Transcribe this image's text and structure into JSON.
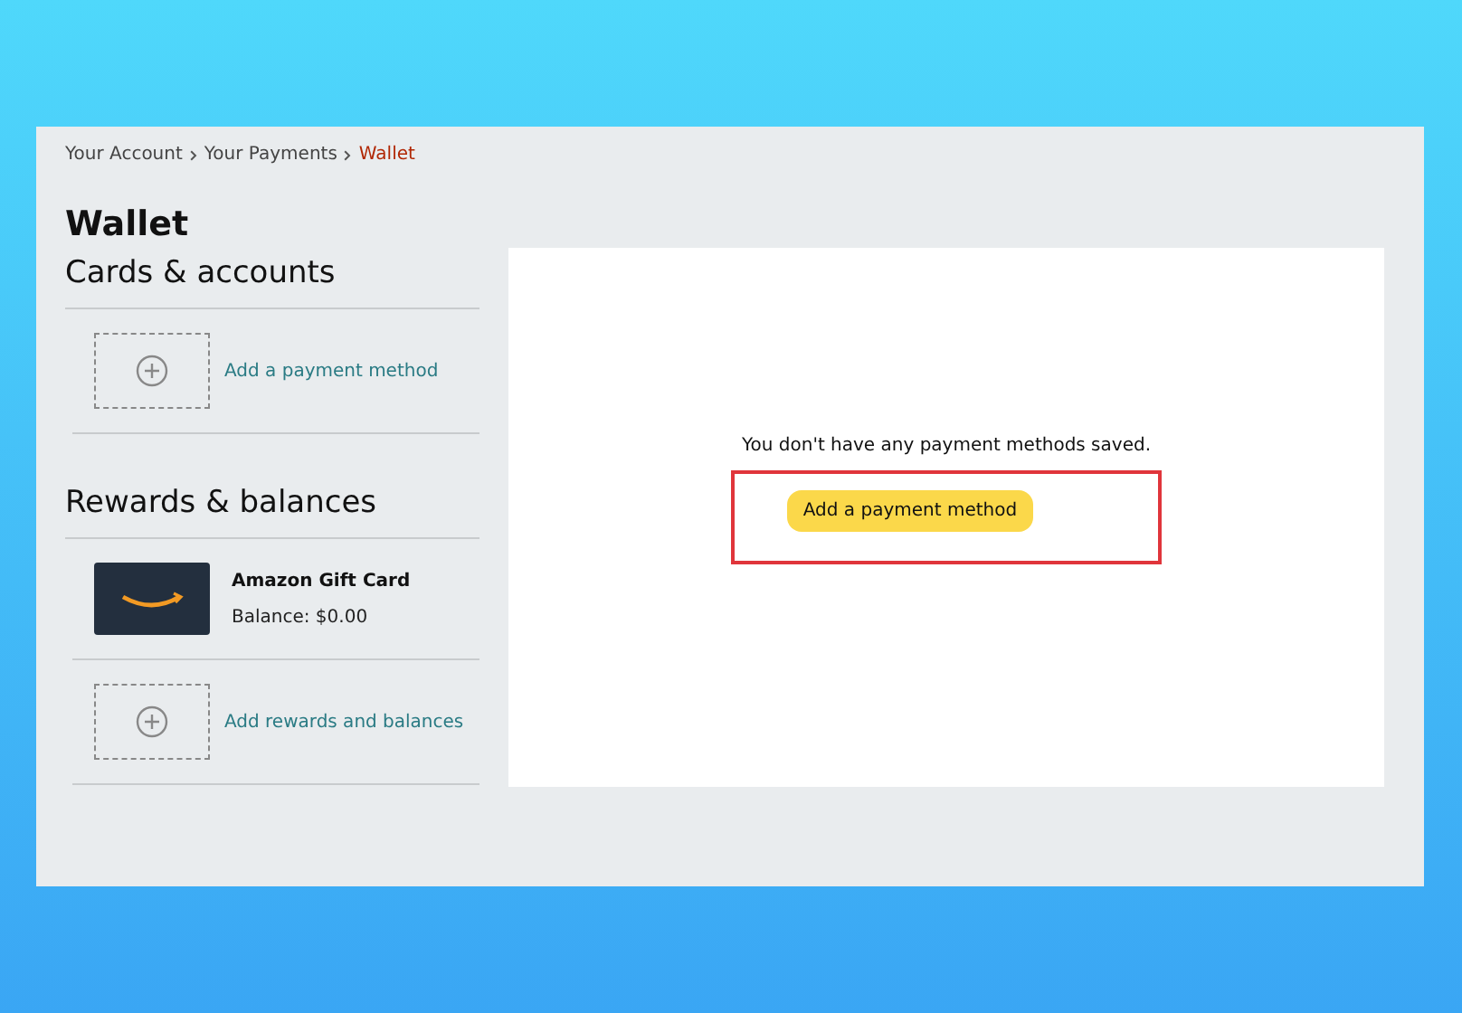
{
  "breadcrumb": [
    {
      "label": "Your Account",
      "current": false
    },
    {
      "label": "Your Payments",
      "current": false
    },
    {
      "label": "Wallet",
      "current": true
    }
  ],
  "title": "Wallet",
  "sections": [
    {
      "heading": "Cards & accounts",
      "items": [
        {
          "kind": "add",
          "label": "Add a payment method"
        }
      ]
    },
    {
      "heading": "Rewards & balances",
      "items": [
        {
          "kind": "gift",
          "name": "Amazon Gift Card",
          "balance": "Balance: $0.00"
        },
        {
          "kind": "add",
          "label": "Add rewards and balances"
        }
      ]
    }
  ],
  "empty_panel": {
    "message": "You don't have any payment methods saved.",
    "button": "Add a payment method",
    "highlighted": true
  }
}
